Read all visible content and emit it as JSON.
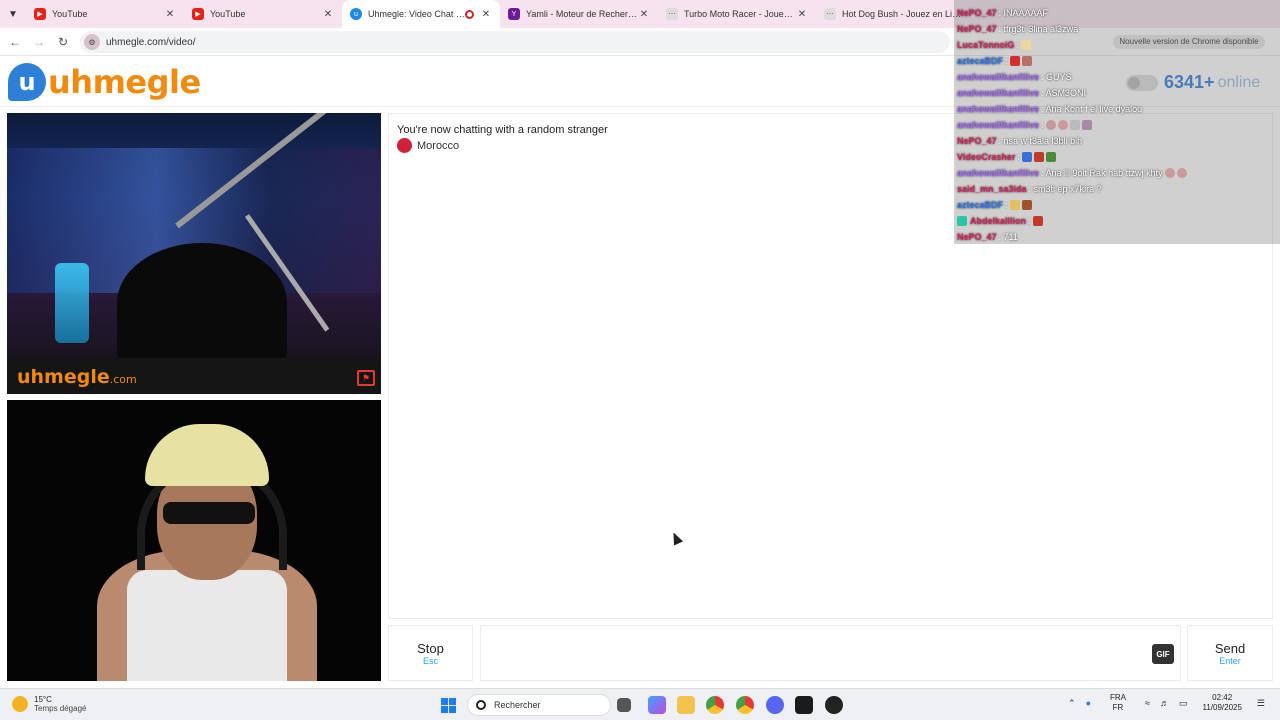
{
  "browser": {
    "tabs": [
      {
        "title": "YouTube",
        "favicon": "youtube"
      },
      {
        "title": "YouTube",
        "favicon": "youtube"
      },
      {
        "title": "Uhmegle: Video Chat | Omegle",
        "favicon": "uhmegle",
        "active": true,
        "recording": true
      },
      {
        "title": "Yamli - Moteur de Recherche Arabe",
        "favicon": "yamli"
      },
      {
        "title": "Turbo Moto Racer - Jouez en Ligne",
        "favicon": "game"
      },
      {
        "title": "Hot Dog Bush - Jouez en Ligne",
        "favicon": "game"
      }
    ],
    "url": "uhmegle.com/video/",
    "update_notice": "Nouvelle version de Chrome disponible"
  },
  "site": {
    "logo_text": "uhmegle",
    "online_count": "6341+",
    "online_label": "online",
    "watermark": "uhmegle",
    "watermark_suffix": ".com"
  },
  "chat": {
    "status": "You're now chatting with a random stranger",
    "country": "Morocco",
    "stop_label": "Stop",
    "stop_hint": "Esc",
    "gif_label": "GIF",
    "send_label": "Send",
    "send_hint": "Enter",
    "message_value": ""
  },
  "stream_chat": [
    {
      "user": "NePO_47",
      "text": ": INAAAAAF",
      "color": "red"
    },
    {
      "user": "NePO_47",
      "text": ": tfrg3ti 3lina al3zwa",
      "color": "red"
    },
    {
      "user": "LucaTonnoiG",
      "text": ":",
      "color": "red"
    },
    {
      "user": "aztecaBDF",
      "text": ":",
      "color": "blue"
    },
    {
      "user": "anahowalilkanfilive",
      "text": ": GUYS",
      "color": "purple"
    },
    {
      "user": "anahowalilkanfilive",
      "text": ": ASM3ONI",
      "color": "purple"
    },
    {
      "user": "anahowalilkanfilive",
      "text": ": Ana Kont f el live dyalou",
      "color": "purple"
    },
    {
      "user": "anahowalilkanfilive",
      "text": ":",
      "color": "purple"
    },
    {
      "user": "NePO_47",
      "text": ": nsa w t3ala l3bli bih",
      "color": "red"
    },
    {
      "user": "VideoCrasher",
      "text": ":",
      "color": "red"
    },
    {
      "user": "anahowalilkanfilive",
      "text": ": Ana lli 9olt Rak hab ttzwj khty",
      "color": "purple"
    },
    {
      "user": "said_mn_sa3ida",
      "text": ": sm3ti ep x7kira ?",
      "color": "red"
    },
    {
      "user": "aztecaBDF",
      "text": ":",
      "color": "blue"
    },
    {
      "user": "Abdelkalllion",
      "text": ":",
      "color": "red"
    },
    {
      "user": "NePO_47",
      "text": ": 711",
      "color": "red"
    }
  ],
  "taskbar": {
    "temp": "15°C",
    "weather": "Temps dégagé",
    "search_placeholder": "Rechercher",
    "lang_top": "FRA",
    "lang_bottom": "FR",
    "time": "02:42",
    "date": "11/09/2025"
  }
}
